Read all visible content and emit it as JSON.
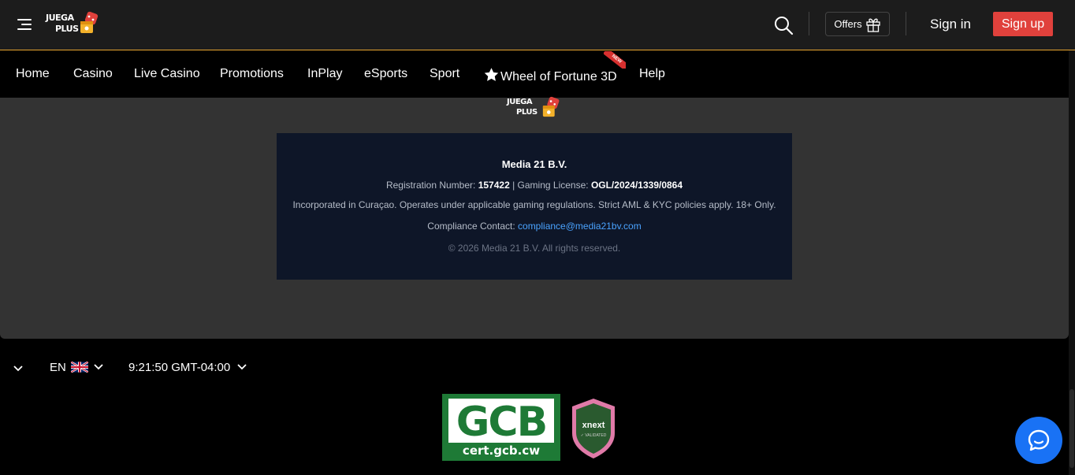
{
  "brand": {
    "logo_line1": "JUEGA",
    "logo_line2": "PLUS",
    "accent": "#e8a531"
  },
  "header": {
    "offers_label": "Offers",
    "signin_label": "Sign in",
    "signup_label": "Sign up",
    "signup_color": "#e0413c"
  },
  "nav": {
    "items": [
      {
        "label": "Home"
      },
      {
        "label": "Casino"
      },
      {
        "label": "Live Casino"
      },
      {
        "label": "Promotions"
      },
      {
        "label": "InPlay"
      },
      {
        "label": "eSports"
      },
      {
        "label": "Sport"
      },
      {
        "label": "Wheel of Fortune 3D",
        "icon": "star-icon",
        "badge": "NEW"
      },
      {
        "label": "Help"
      }
    ]
  },
  "license": {
    "company": "Media 21 B.V.",
    "reg_label": "Registration Number:",
    "reg_number": "157422",
    "gaming_label": "| Gaming License:",
    "gaming_license": "OGL/2024/1339/0864",
    "incorporated": "Incorporated in Curaçao. Operates under applicable gaming regulations. Strict AML & KYC policies apply. 18+ Only.",
    "contact_label": "Compliance Contact:",
    "contact_email": "compliance@media21bv.com",
    "copyright": "© 2026 Media 21 B.V. All rights reserved."
  },
  "footer": {
    "language": "EN",
    "time": "9:21:50 GMT-04:00",
    "gcb_title": "GCB",
    "gcb_url": "cert.gcb.cw",
    "xnext_title": "xnext",
    "xnext_sub": "✓ VALIDATED"
  }
}
